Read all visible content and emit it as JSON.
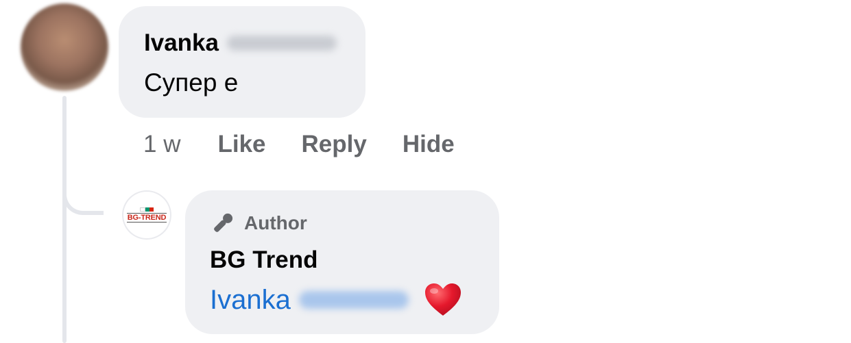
{
  "comment": {
    "author_first_name": "Ivanka",
    "text": "Супер е",
    "time": "1 w",
    "actions": {
      "like": "Like",
      "reply": "Reply",
      "hide": "Hide"
    }
  },
  "reply": {
    "badge_label": "Author",
    "badge_icon": "microphone-icon",
    "page_name": "BG Trend",
    "mention_first_name": "Ivanka",
    "reaction_icon": "heart-emoji-icon",
    "page_logo_text": "BG-TREND"
  },
  "colors": {
    "bubble_bg": "#eff0f3",
    "meta_text": "#65676b",
    "mention_link": "#1b6fd1",
    "heart": "#e0182c"
  }
}
